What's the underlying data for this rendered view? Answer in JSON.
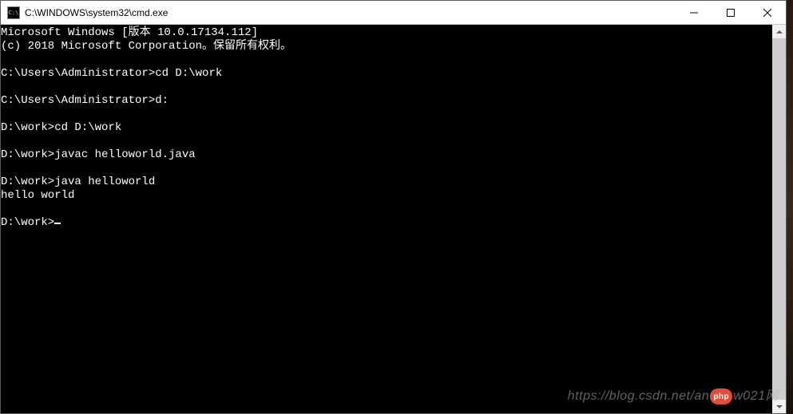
{
  "titlebar": {
    "icon_label": "C:\\",
    "title": "C:\\WINDOWS\\system32\\cmd.exe"
  },
  "terminal": {
    "lines": [
      "Microsoft Windows [版本 10.0.17134.112]",
      "(c) 2018 Microsoft Corporation。保留所有权利。",
      "",
      "C:\\Users\\Administrator>cd D:\\work",
      "",
      "C:\\Users\\Administrator>d:",
      "",
      "D:\\work>cd D:\\work",
      "",
      "D:\\work>javac helloworld.java",
      "",
      "D:\\work>java helloworld",
      "hello world",
      "",
      "D:\\work>"
    ]
  },
  "watermark": {
    "url_prefix": "https://blog.csdn.net/an",
    "badge": "php",
    "url_suffix": "w021网"
  }
}
